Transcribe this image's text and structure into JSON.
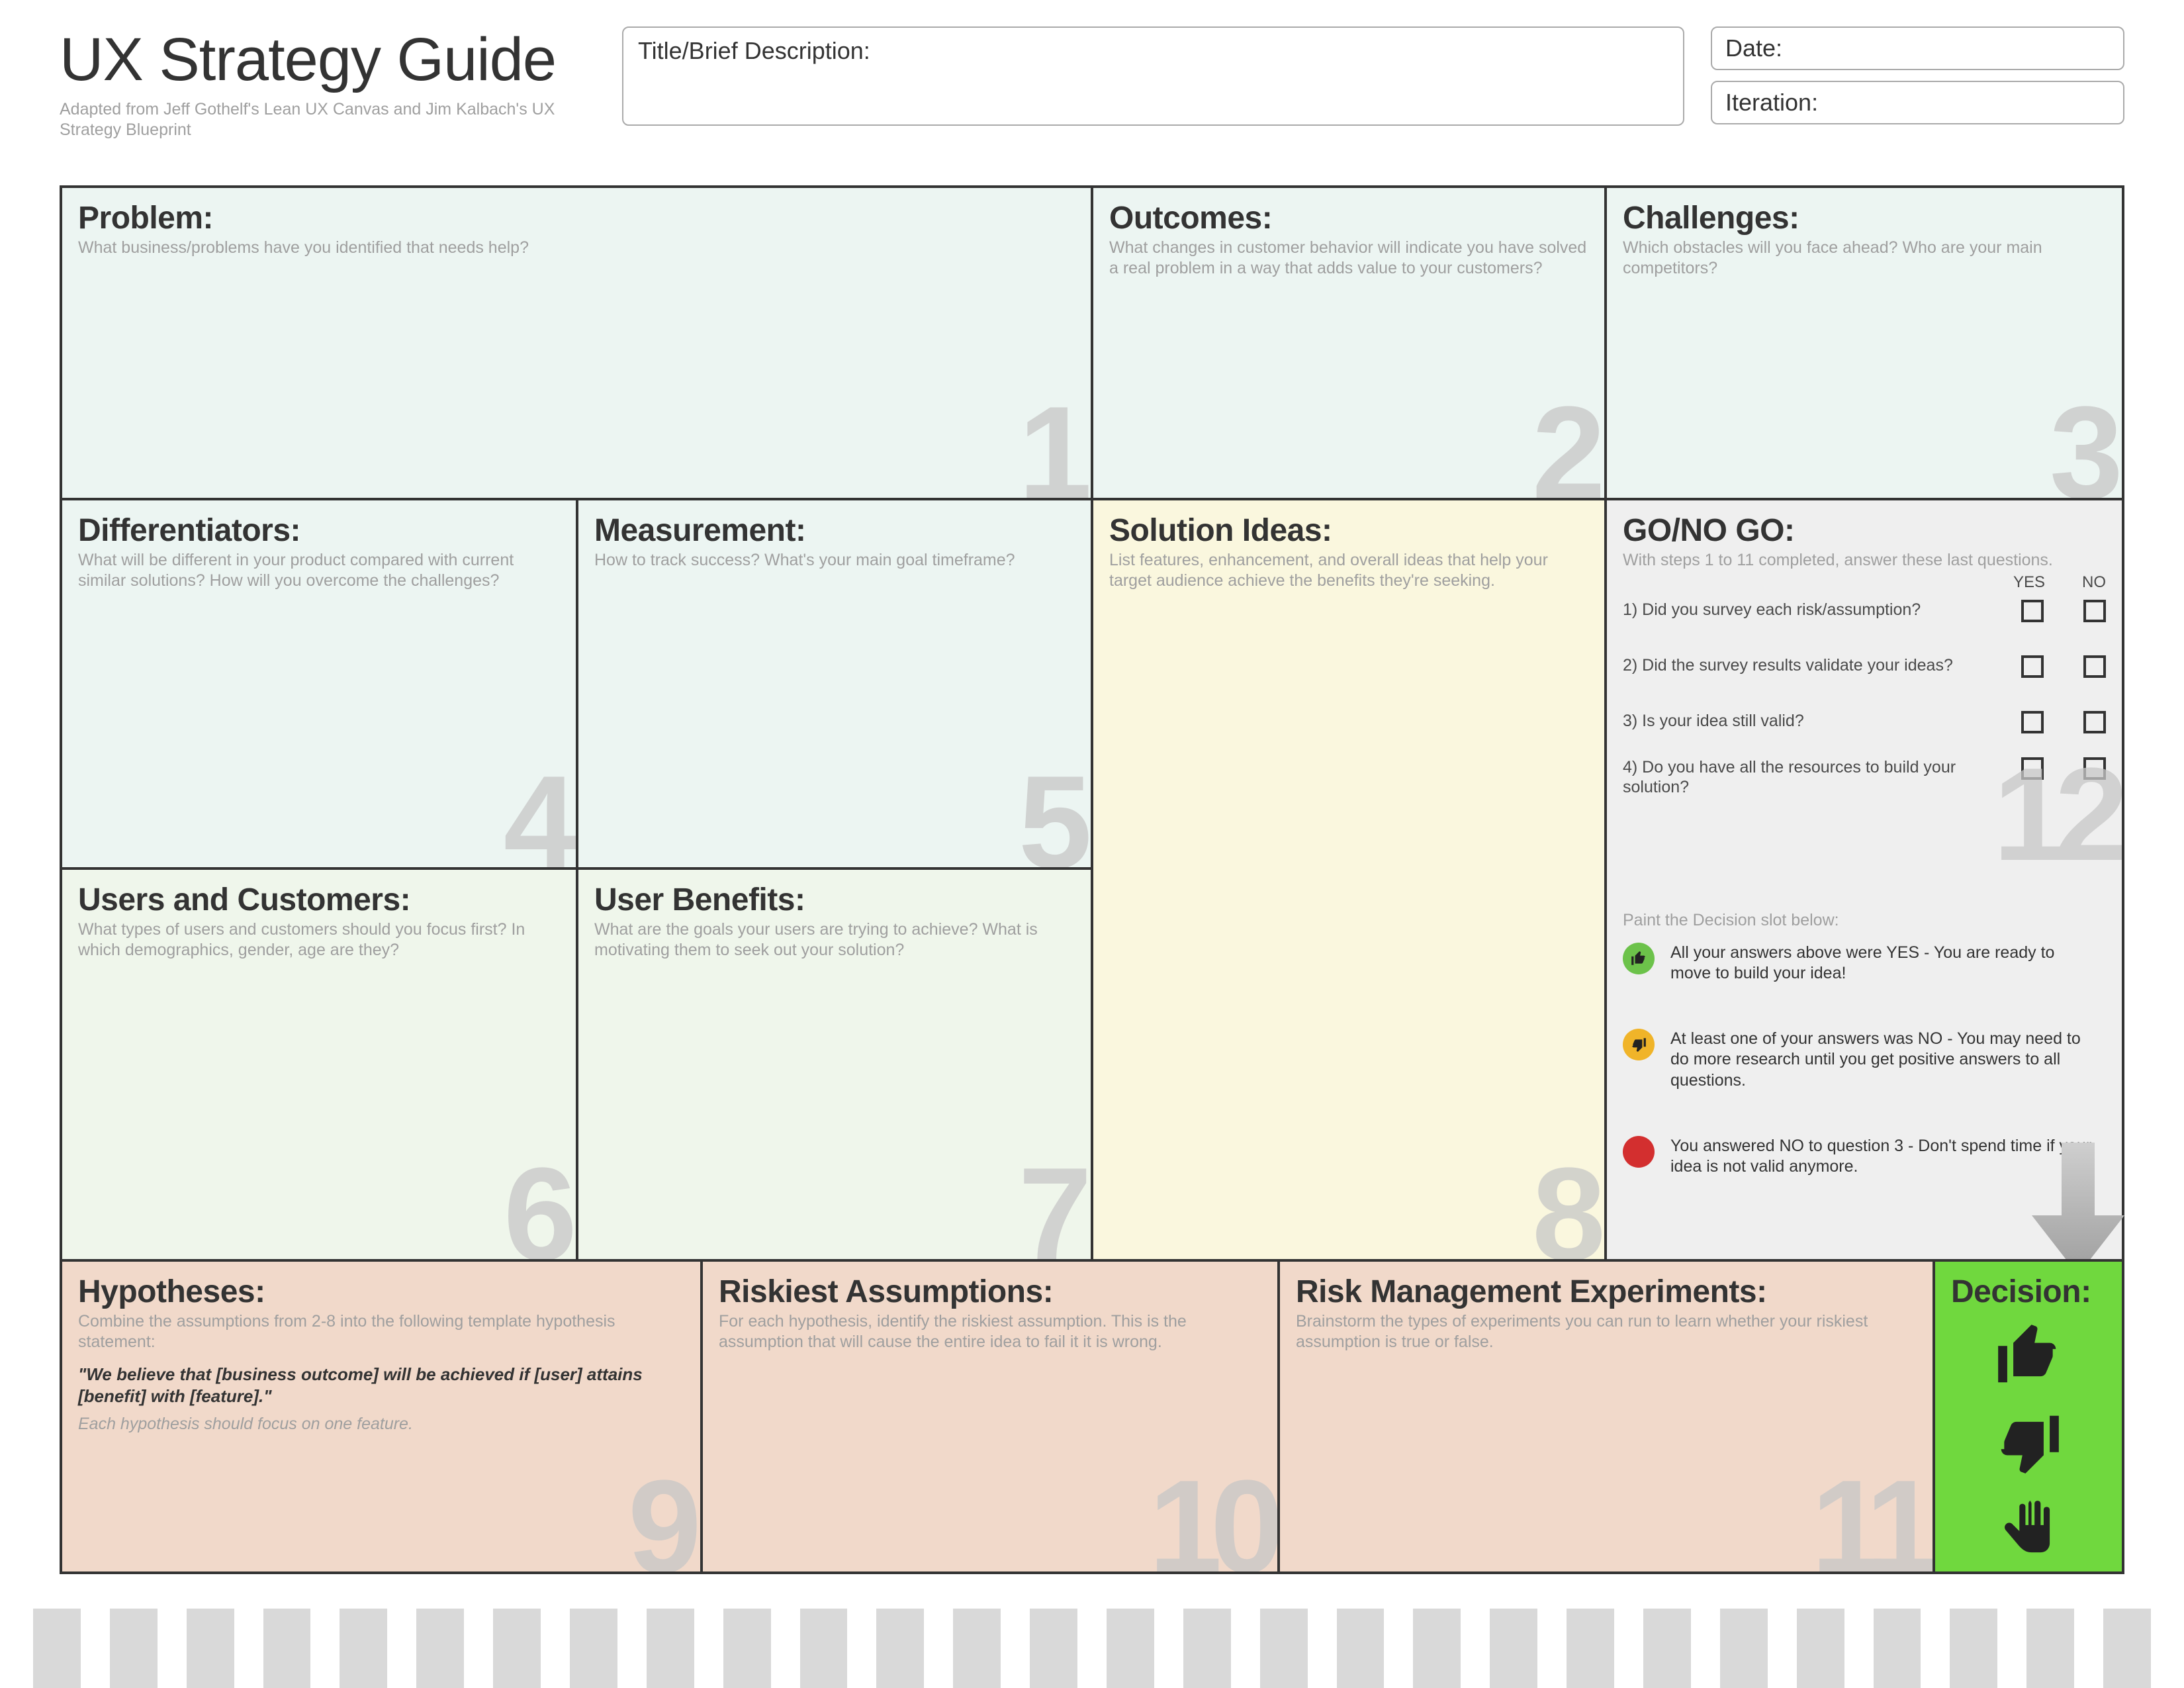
{
  "header": {
    "title": "UX Strategy Guide",
    "subtitle": "Adapted from Jeff Gothelf's Lean UX Canvas and Jim Kalbach's UX Strategy Blueprint",
    "title_box_label": "Title/Brief Description:",
    "date_label": "Date:",
    "iteration_label": "Iteration:"
  },
  "cells": {
    "problem": {
      "num": "1",
      "title": "Problem:",
      "hint": "What business/problems have you identified that needs help?"
    },
    "outcomes": {
      "num": "2",
      "title": "Outcomes:",
      "hint": "What changes in customer behavior will indicate you have solved a real problem in a way that adds value to your customers?"
    },
    "challenges": {
      "num": "3",
      "title": "Challenges:",
      "hint": "Which obstacles will you face ahead? Who are your main competitors?"
    },
    "differentiators": {
      "num": "4",
      "title": "Differentiators:",
      "hint": "What will be different in your product compared with current similar solutions? How will you overcome the challenges?"
    },
    "measurement": {
      "num": "5",
      "title": "Measurement:",
      "hint": "How to track success? What's your main goal timeframe?"
    },
    "users": {
      "num": "6",
      "title": "Users and Customers:",
      "hint": "What types of users and customers should you focus first? In which demographics, gender, age are they?"
    },
    "benefits": {
      "num": "7",
      "title": "User Benefits:",
      "hint": "What are the goals your users are trying to achieve? What is motivating them to seek out your solution?"
    },
    "ideas": {
      "num": "8",
      "title": "Solution Ideas:",
      "hint": "List features, enhancement, and overall ideas that help your target audience achieve the benefits they're seeking."
    },
    "hypotheses": {
      "num": "9",
      "title": "Hypotheses:",
      "hint": "Combine the assumptions from 2-8 into the following template hypothesis statement:",
      "quote": "\"We believe that [business outcome] will be achieved if [user] attains [benefit] with [feature].\"",
      "note": "Each hypothesis should focus on one feature."
    },
    "riskiest": {
      "num": "10",
      "title": "Riskiest Assumptions:",
      "hint": "For each hypothesis, identify the riskiest assumption. This is the assumption that will cause the entire idea to fail it it is wrong."
    },
    "experiments": {
      "num": "11",
      "title": "Risk Management Experiments:",
      "hint": "Brainstorm the types of experiments you can run to learn whether your riskiest assumption is true or false."
    },
    "gonogo": {
      "num": "12",
      "title": "GO/NO GO:",
      "hint": "With steps 1 to 11 completed, answer these last questions."
    },
    "decision": {
      "title": "Decision:"
    }
  },
  "gonogo": {
    "yes_label": "YES",
    "no_label": "NO",
    "questions": {
      "q1": "1) Did you survey each risk/assumption?",
      "q2": "2) Did the survey results validate your ideas?",
      "q3": "3) Is your idea still valid?",
      "q4": "4) Do you have all the resources to build your solution?"
    },
    "paint_note": "Paint the Decision slot below:",
    "legend": {
      "green": "All your answers above were YES - You are ready to move to build your idea!",
      "yellow": "At least one of your answers was NO - You may need to do more research until you get positive answers to all questions.",
      "red": "You answered NO to question 3 - Don't spend time if your idea is not valid anymore."
    }
  }
}
